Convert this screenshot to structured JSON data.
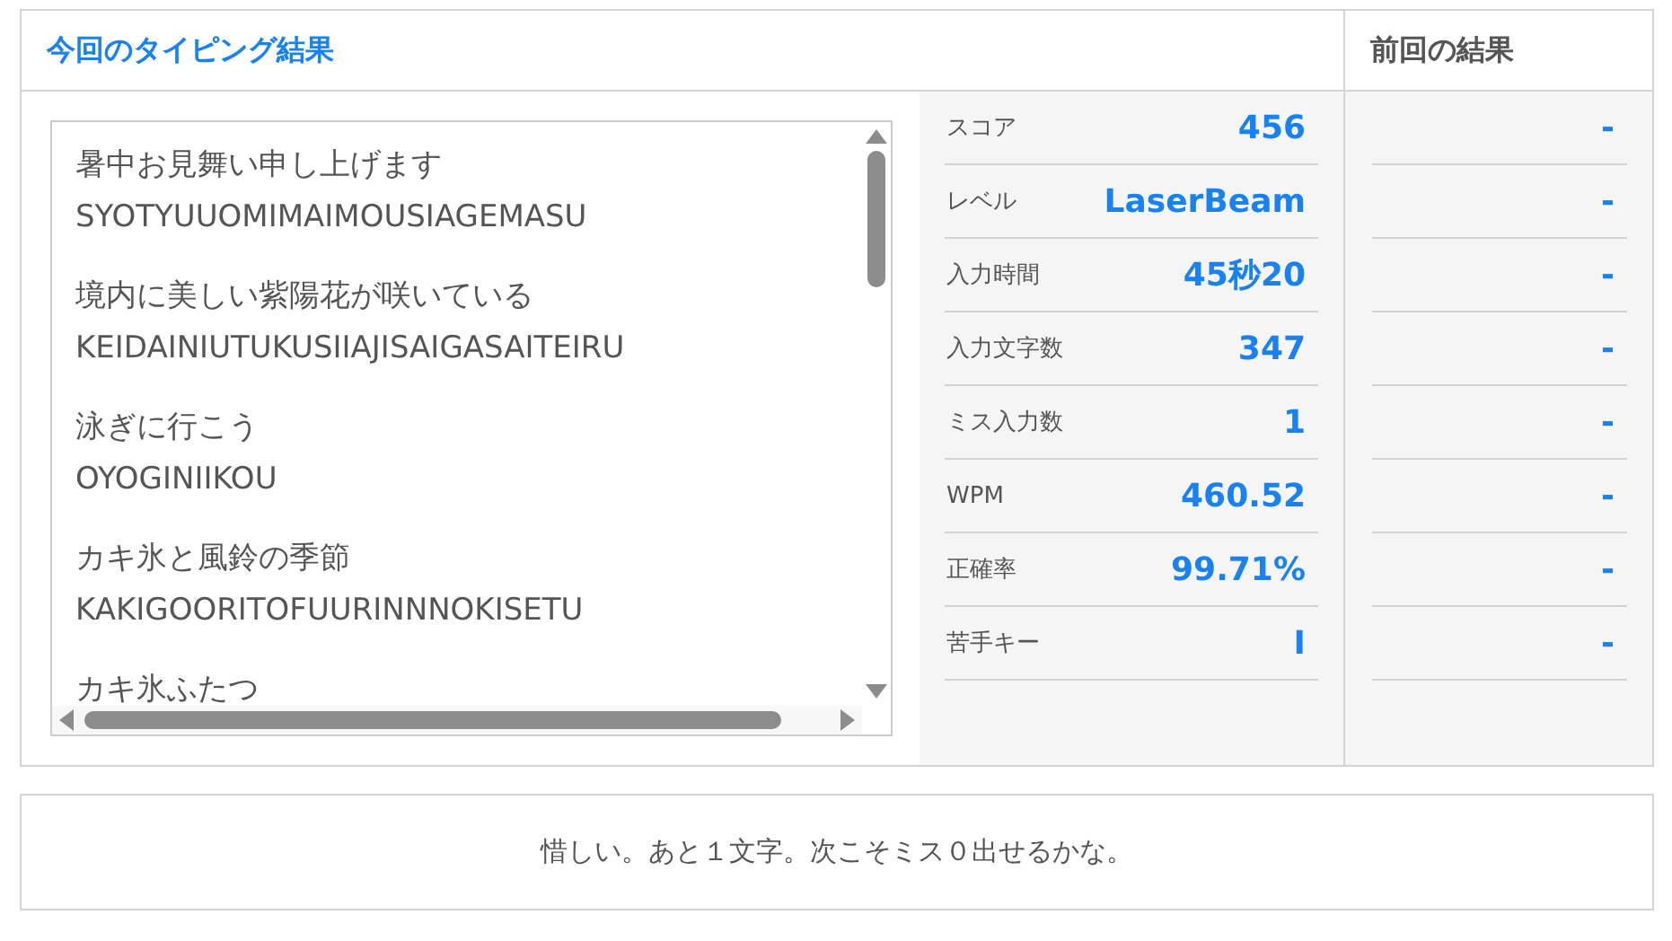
{
  "current_title": "今回のタイピング結果",
  "previous_title": "前回の結果",
  "typed_lines": [
    {
      "japanese": "暑中お見舞い申し上げます",
      "romaji": "SYOTYUUOMIMAIMOUSIAGEMASU"
    },
    {
      "japanese": "境内に美しい紫陽花が咲いている",
      "romaji": "KEIDAINIUTUKUSIIAJISAIGASAITEIRU"
    },
    {
      "japanese": "泳ぎに行こう",
      "romaji": "OYOGINIIKOU"
    },
    {
      "japanese": "カキ氷と風鈴の季節",
      "romaji": "KAKIGOORITOFUURINNNOKISETU"
    },
    {
      "japanese": "カキ氷ふたつ"
    }
  ],
  "stats": [
    {
      "label": "スコア",
      "value": "456"
    },
    {
      "label": "レベル",
      "value": "LaserBeam"
    },
    {
      "label": "入力時間",
      "value": "45秒20"
    },
    {
      "label": "入力文字数",
      "value": "347"
    },
    {
      "label": "ミス入力数",
      "value": "1"
    },
    {
      "label": "WPM",
      "value": "460.52"
    },
    {
      "label": "正確率",
      "value": "99.71%"
    },
    {
      "label": "苦手キー",
      "value": "I"
    }
  ],
  "previous_results": [
    "-",
    "-",
    "-",
    "-",
    "-",
    "-",
    "-",
    "-"
  ],
  "message": "惜しい。あと１文字。次こそミス０出せるかな。"
}
